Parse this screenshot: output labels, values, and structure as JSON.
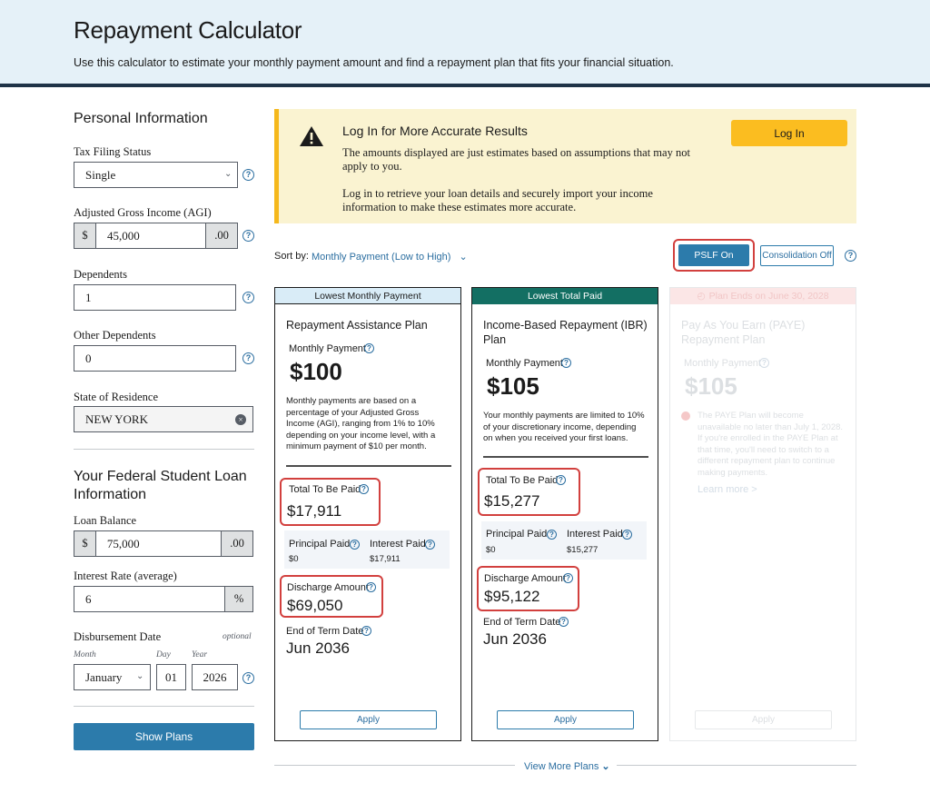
{
  "header": {
    "title": "Repayment Calculator",
    "subtitle": "Use this calculator to estimate your monthly payment amount and find a repayment plan that fits your financial situation."
  },
  "sidebar": {
    "personal_heading": "Personal Information",
    "tax_status": {
      "label": "Tax Filing Status",
      "value": "Single"
    },
    "agi": {
      "label": "Adjusted Gross Income (AGI)",
      "prefix": "$",
      "value": "45,000",
      "suffix": ".00"
    },
    "dependents": {
      "label": "Dependents",
      "value": "1"
    },
    "other_dependents": {
      "label": "Other Dependents",
      "value": "0"
    },
    "state": {
      "label": "State of Residence",
      "value": "NEW YORK"
    },
    "loan_heading_line1": "Your Federal Student Loan",
    "loan_heading_line2": "Information",
    "loan_balance": {
      "label": "Loan Balance",
      "prefix": "$",
      "value": "75,000",
      "suffix": ".00"
    },
    "interest_rate": {
      "label": "Interest Rate (average)",
      "value": "6",
      "suffix": "%"
    },
    "disbursement": {
      "label": "Disbursement Date",
      "optional": "optional",
      "month_label": "Month",
      "month_value": "January",
      "day_label": "Day",
      "day_value": "01",
      "year_label": "Year",
      "year_value": "2026"
    },
    "show_plans": "Show Plans"
  },
  "alert": {
    "title": "Log In for More Accurate Results",
    "line1": "The amounts displayed are just estimates based on assumptions that may not apply to you.",
    "line2": "Log in to retrieve your loan details and securely import your income information to make these estimates more accurate.",
    "login": "Log In"
  },
  "sort": {
    "label": "Sort by:",
    "value": "Monthly Payment (Low to High)",
    "pslf": "PSLF On",
    "consolidation": "Consolidation Off"
  },
  "cards": [
    {
      "tag": "Lowest Monthly Payment",
      "title": "Repayment Assistance Plan",
      "monthly_label": "Monthly Payment",
      "monthly": "$100",
      "desc": "Monthly payments are based on a percentage of your Adjusted Gross Income (AGI), ranging from 1% to 10% depending on your income level, with a minimum payment of $10 per month.",
      "total_label": "Total To Be Paid",
      "total": "$17,911",
      "principal_label": "Principal Paid",
      "principal": "$0",
      "interest_label": "Interest Paid",
      "interest": "$17,911",
      "discharge_label": "Discharge Amount",
      "discharge": "$69,050",
      "end_label": "End of Term Date",
      "end": "Jun 2036",
      "apply": "Apply"
    },
    {
      "tag": "Lowest Total Paid",
      "title_line1": "Income-Based Repayment (IBR)",
      "title_line2": "Plan",
      "monthly_label": "Monthly Payment",
      "monthly": "$105",
      "desc": "Your monthly payments are limited to 10% of your discretionary income, depending on when you received your first loans.",
      "total_label": "Total To Be Paid",
      "total": "$15,277",
      "principal_label": "Principal Paid",
      "principal": "$0",
      "interest_label": "Interest Paid",
      "interest": "$15,277",
      "discharge_label": "Discharge Amount",
      "discharge": "$95,122",
      "end_label": "End of Term Date",
      "end": "Jun 2036",
      "apply": "Apply"
    },
    {
      "tag": "Plan Ends on June 30, 2028",
      "title_line1": "Pay As You Earn (PAYE)",
      "title_line2": "Repayment Plan",
      "monthly_label": "Monthly Payment",
      "monthly": "$105",
      "warning": "The PAYE Plan will become unavailable no later than July 1, 2028. If you're enrolled in the PAYE Plan at that time, you'll need to switch to a different repayment plan to continue making payments.",
      "learn_more": "Learn more >",
      "apply": "Apply"
    }
  ],
  "view_more": "View More Plans"
}
